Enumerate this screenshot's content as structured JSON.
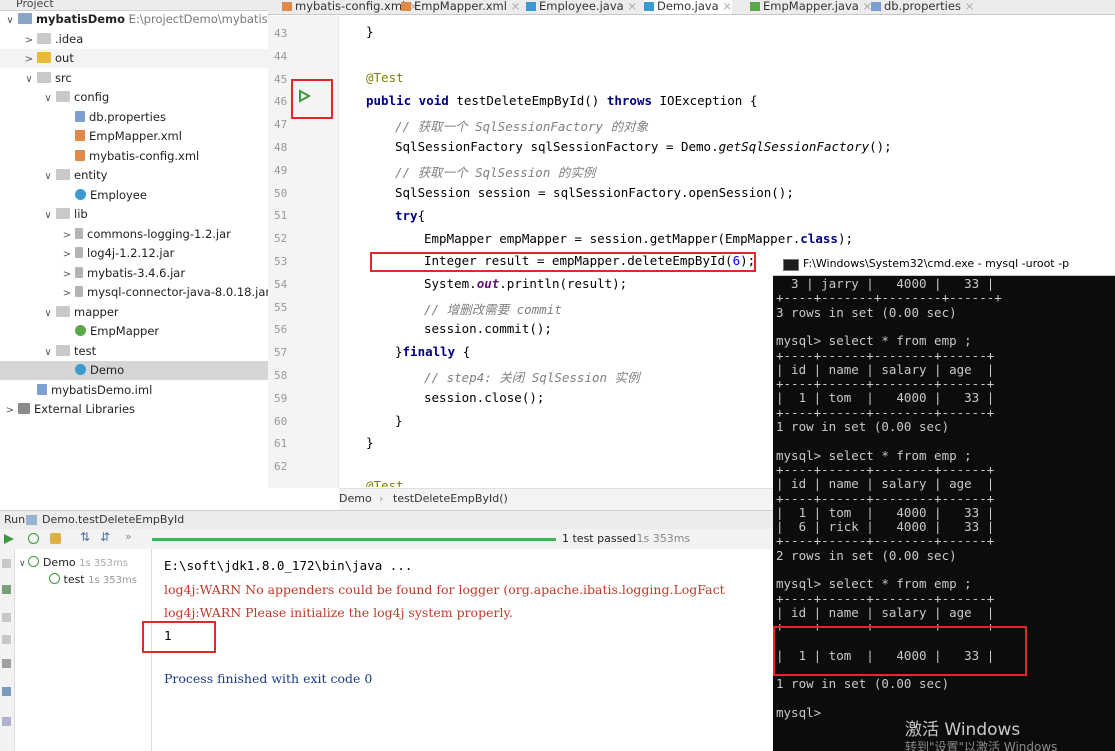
{
  "project": {
    "header": "Project",
    "tree": [
      {
        "label": "mybatisDemo",
        "suffix": "E:\\projectDemo\\mybatisDem",
        "indent": 0,
        "arrow": "∨",
        "icon": "module",
        "bold": true
      },
      {
        "label": ".idea",
        "indent": 1,
        "arrow": ">",
        "icon": "folder"
      },
      {
        "label": "out",
        "indent": 1,
        "arrow": ">",
        "icon": "out",
        "selected_light": true
      },
      {
        "label": "src",
        "indent": 1,
        "arrow": "∨",
        "icon": "folder"
      },
      {
        "label": "config",
        "indent": 2,
        "arrow": "∨",
        "icon": "folder"
      },
      {
        "label": "db.properties",
        "indent": 3,
        "arrow": "",
        "icon": "file"
      },
      {
        "label": "EmpMapper.xml",
        "indent": 3,
        "arrow": "",
        "icon": "xml"
      },
      {
        "label": "mybatis-config.xml",
        "indent": 3,
        "arrow": "",
        "icon": "xml"
      },
      {
        "label": "entity",
        "indent": 2,
        "arrow": "∨",
        "icon": "folder"
      },
      {
        "label": "Employee",
        "indent": 3,
        "arrow": "",
        "icon": "class"
      },
      {
        "label": "lib",
        "indent": 2,
        "arrow": "∨",
        "icon": "folder"
      },
      {
        "label": "commons-logging-1.2.jar",
        "indent": 3,
        "arrow": ">",
        "icon": "jar"
      },
      {
        "label": "log4j-1.2.12.jar",
        "indent": 3,
        "arrow": ">",
        "icon": "jar"
      },
      {
        "label": "mybatis-3.4.6.jar",
        "indent": 3,
        "arrow": ">",
        "icon": "jar"
      },
      {
        "label": "mysql-connector-java-8.0.18.jar",
        "indent": 3,
        "arrow": ">",
        "icon": "jar"
      },
      {
        "label": "mapper",
        "indent": 2,
        "arrow": "∨",
        "icon": "folder"
      },
      {
        "label": "EmpMapper",
        "indent": 3,
        "arrow": "",
        "icon": "interface"
      },
      {
        "label": "test",
        "indent": 2,
        "arrow": "∨",
        "icon": "folder"
      },
      {
        "label": "Demo",
        "indent": 3,
        "arrow": "",
        "icon": "class",
        "selected": true
      },
      {
        "label": "mybatisDemo.iml",
        "indent": 1,
        "arrow": "",
        "icon": "file"
      },
      {
        "label": "External Libraries",
        "indent": 0,
        "arrow": ">",
        "icon": "lib"
      }
    ]
  },
  "tabs": [
    {
      "label": "mybatis-config.xml",
      "icon": "xml"
    },
    {
      "label": "EmpMapper.xml",
      "icon": "xml"
    },
    {
      "label": "Employee.java",
      "icon": "class"
    },
    {
      "label": "Demo.java",
      "icon": "class",
      "active": true
    },
    {
      "label": "EmpMapper.java",
      "icon": "interface"
    },
    {
      "label": "db.properties",
      "icon": "file"
    }
  ],
  "editor": {
    "line_numbers": [
      "43",
      "44",
      "45",
      "46",
      "47",
      "48",
      "49",
      "50",
      "51",
      "52",
      "53",
      "54",
      "55",
      "56",
      "57",
      "58",
      "59",
      "60",
      "61",
      "62"
    ],
    "code": {
      "l43": "}",
      "l45": "@Test",
      "l46a": "public void",
      "l46b": " testDeleteEmpById() ",
      "l46c": "throws",
      "l46d": " IOException {",
      "l47": "// 获取一个 SqlSessionFactory 的对象",
      "l48a": "SqlSessionFactory sqlSessionFactory = Demo.",
      "l48b": "getSqlSessionFactory",
      "l48c": "();",
      "l49": "// 获取一个 SqlSession 的实例",
      "l50": "SqlSession session = sqlSessionFactory.openSession();",
      "l51a": "try",
      "l51b": "{",
      "l52a": "EmpMapper empMapper = session.getMapper(EmpMapper.",
      "l52b": "class",
      "l52c": ");",
      "l53a": "Integer result = empMapper.deleteEmpById(",
      "l53b": "6",
      "l53c": ");",
      "l54a": "System.",
      "l54b": "out",
      "l54c": ".println(result);",
      "l55": "// 增删改需要 commit",
      "l56": "session.commit();",
      "l57a": "}",
      "l57b": "finally",
      "l57c": " {",
      "l58": "// step4: 关闭 SqlSession 实例",
      "l59": "session.close();",
      "l60": "}",
      "l61": "}",
      "l63": "@Test"
    },
    "breadcrumb": [
      "Demo",
      "testDeleteEmpById()"
    ],
    "breadcrumb_sep": "›"
  },
  "run": {
    "header_label": "Run",
    "config_name": "Demo.testDeleteEmpById",
    "status": "1 test passed",
    "status_time": " - 1s 353ms",
    "tree": [
      {
        "label": "Demo",
        "time": "1s 353ms"
      },
      {
        "label": "test",
        "time": "1s 353ms"
      }
    ],
    "console": [
      {
        "text": "E:\\soft\\jdk1.8.0_172\\bin\\java ...",
        "style": "cmd"
      },
      {
        "text": "log4j:WARN No appenders could be found for logger (org.apache.ibatis.logging.LogFact",
        "style": "warn"
      },
      {
        "text": "log4j:WARN Please initialize the log4j system properly.",
        "style": "warn"
      },
      {
        "text": "1",
        "style": "out"
      },
      {
        "text": "Process finished with exit code 0",
        "style": "exit"
      }
    ]
  },
  "cmd": {
    "title": "F:\\Windows\\System32\\cmd.exe - mysql  -uroot -p",
    "lines": [
      "  3 | jarry |   4000 |   33 |",
      "+----+-------+--------+------+",
      "3 rows in set (0.00 sec)",
      "",
      "mysql> select * from emp ;",
      "+----+------+--------+------+",
      "| id | name | salary | age  |",
      "+----+------+--------+------+",
      "|  1 | tom  |   4000 |   33 |",
      "+----+------+--------+------+",
      "1 row in set (0.00 sec)",
      "",
      "mysql> select * from emp ;",
      "+----+------+--------+------+",
      "| id | name | salary | age  |",
      "+----+------+--------+------+",
      "|  1 | tom  |   4000 |   33 |",
      "|  6 | rick |   4000 |   33 |",
      "+----+------+--------+------+",
      "2 rows in set (0.00 sec)",
      "",
      "mysql> select * from emp ;",
      "+----+------+--------+------+",
      "| id | name | salary | age  |",
      "+----+------+--------+------+",
      "",
      "|  1 | tom  |   4000 |   33 |",
      "",
      "1 row in set (0.00 sec)",
      "",
      "mysql>"
    ],
    "watermark_title": "激活 Windows",
    "watermark_sub": "转到\"设置\"以激活 Windows"
  }
}
